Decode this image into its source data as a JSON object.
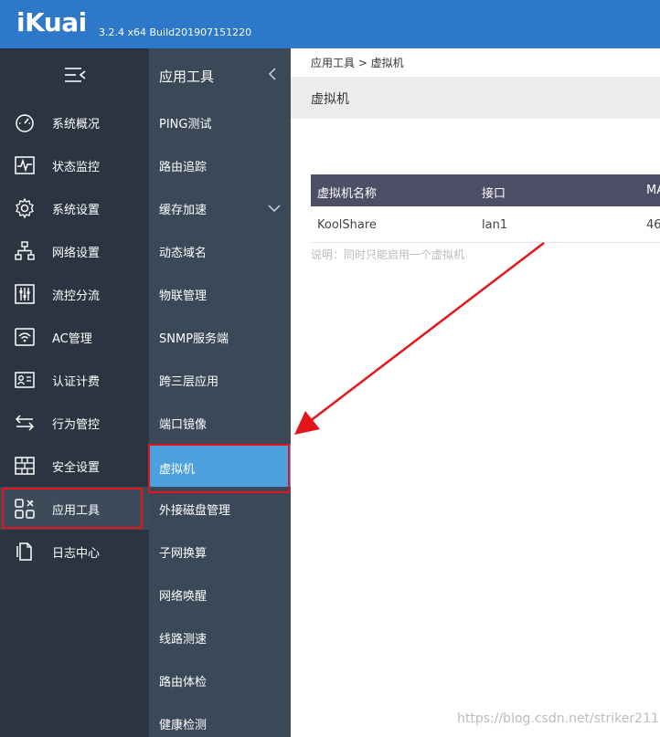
{
  "header": {
    "logo": "iKuai",
    "version": "3.2.4 x64 Build201907151220"
  },
  "colors": {
    "header_bg": "#2d78c8",
    "sidebar_bg": "#2b3541",
    "submenu_bg": "#3a4858",
    "submenu_active": "#4da0de",
    "highlight_red": "#e3151b",
    "table_header": "#4e4f67"
  },
  "sidebar": {
    "toggle_icon": "menu-collapse-icon",
    "items": [
      {
        "label": "系统概况",
        "icon": "dashboard-icon"
      },
      {
        "label": "状态监控",
        "icon": "pulse-icon"
      },
      {
        "label": "系统设置",
        "icon": "gear-icon"
      },
      {
        "label": "网络设置",
        "icon": "network-icon"
      },
      {
        "label": "流控分流",
        "icon": "sliders-icon"
      },
      {
        "label": "AC管理",
        "icon": "wifi-icon"
      },
      {
        "label": "认证计费",
        "icon": "id-card-icon"
      },
      {
        "label": "行为管控",
        "icon": "swap-arrows-icon"
      },
      {
        "label": "安全设置",
        "icon": "firewall-icon"
      },
      {
        "label": "应用工具",
        "icon": "apps-icon",
        "active": true
      },
      {
        "label": "日志中心",
        "icon": "document-icon"
      }
    ]
  },
  "submenu": {
    "title": "应用工具",
    "items": [
      {
        "label": "PING测试"
      },
      {
        "label": "路由追踪"
      },
      {
        "label": "缓存加速"
      },
      {
        "label": "动态域名"
      },
      {
        "label": "物联管理"
      },
      {
        "label": "SNMP服务端"
      },
      {
        "label": "跨三层应用"
      },
      {
        "label": "端口镜像"
      },
      {
        "label": "虚拟机",
        "active": true
      },
      {
        "label": "外接磁盘管理"
      },
      {
        "label": "子网换算"
      },
      {
        "label": "网络唤醒"
      },
      {
        "label": "线路测速"
      },
      {
        "label": "路由体检"
      },
      {
        "label": "健康检测"
      }
    ]
  },
  "content": {
    "breadcrumb": "应用工具 > 虚拟机",
    "page_title": "虚拟机",
    "table": {
      "headers": [
        "虚拟机名称",
        "接口",
        "MA"
      ],
      "rows": [
        [
          "KoolShare",
          "lan1",
          "46"
        ]
      ]
    },
    "note": "说明：同时只能启用一个虚拟机"
  },
  "watermark": "https://blog.csdn.net/striker211"
}
